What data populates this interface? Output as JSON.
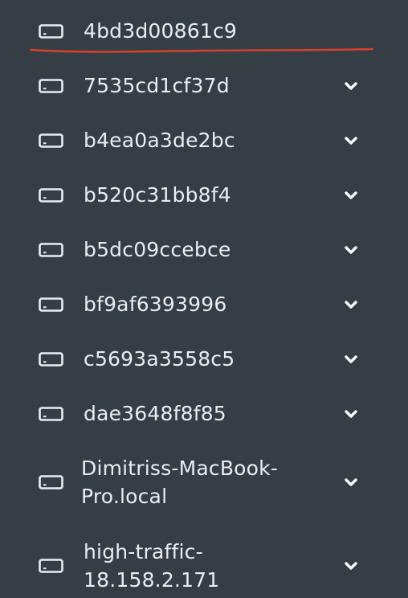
{
  "hosts": [
    {
      "label": "4bd3d00861c9",
      "icon": "server-icon",
      "expandable": false,
      "selected": true
    },
    {
      "label": "7535cd1cf37d",
      "icon": "server-icon",
      "expandable": true
    },
    {
      "label": "b4ea0a3de2bc",
      "icon": "server-icon",
      "expandable": true
    },
    {
      "label": "b520c31bb8f4",
      "icon": "server-icon",
      "expandable": true
    },
    {
      "label": "b5dc09ccebce",
      "icon": "server-icon",
      "expandable": true
    },
    {
      "label": "bf9af6393996",
      "icon": "server-icon",
      "expandable": true
    },
    {
      "label": "c5693a3558c5",
      "icon": "server-icon",
      "expandable": true
    },
    {
      "label": "dae3648f8f85",
      "icon": "server-icon",
      "expandable": true
    },
    {
      "label": "Dimitriss-MacBook-\nPro.local",
      "icon": "server-icon",
      "expandable": true
    },
    {
      "label": "high-traffic-\n18.158.2.171",
      "icon": "server-icon",
      "expandable": true
    }
  ],
  "colors": {
    "background": "#363e45",
    "text": "#e9edf1",
    "annotation_underline": "#d9402b"
  }
}
